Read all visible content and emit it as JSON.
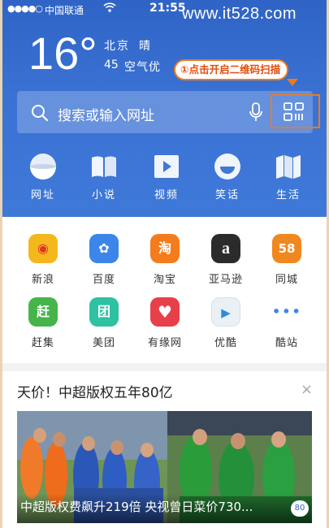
{
  "status_bar": {
    "signal": "●●●●○",
    "carrier": "中国联通",
    "time": "21:55"
  },
  "watermark": "www.it528.com",
  "weather": {
    "temperature": "16°",
    "city": "北京",
    "condition": "晴",
    "aqi_value": "45",
    "aqi_label": "空气优"
  },
  "annotation": {
    "text": "①点击开启二维码扫描",
    "color": "#f07a1a"
  },
  "search": {
    "placeholder": "搜索或输入网址",
    "search_icon": "search-icon",
    "mic_icon": "microphone-icon",
    "scan_icon": "qr-scan-icon"
  },
  "quick_links": [
    {
      "label": "网址",
      "icon": "globe-icon"
    },
    {
      "label": "小说",
      "icon": "book-icon"
    },
    {
      "label": "视频",
      "icon": "play-icon"
    },
    {
      "label": "笑话",
      "icon": "smile-icon"
    },
    {
      "label": "生活",
      "icon": "map-icon"
    }
  ],
  "sites": [
    {
      "label": "新浪",
      "glyph": "◉",
      "color": "#f5b81c"
    },
    {
      "label": "百度",
      "glyph": "✿",
      "color": "#3b86e8"
    },
    {
      "label": "淘宝",
      "glyph": "淘",
      "color": "#f47c1c"
    },
    {
      "label": "亚马逊",
      "glyph": "a",
      "color": "#2b2b2b"
    },
    {
      "label": "同城",
      "glyph": "58",
      "color": "#f0881f"
    },
    {
      "label": "赶集",
      "glyph": "赶",
      "color": "#45b54a"
    },
    {
      "label": "美团",
      "glyph": "团",
      "color": "#2fc1a2"
    },
    {
      "label": "有缘网",
      "glyph": "♥",
      "color": "#e8404a"
    },
    {
      "label": "优酷",
      "glyph": "▶",
      "color": "#e9f1f6"
    },
    {
      "label": "酷站",
      "glyph": "•••",
      "color": "#ffffff"
    }
  ],
  "news": {
    "title": "天价！中超版权五年80亿",
    "close": "×",
    "caption": "中超版权费飙升219倍 央视曾日菜价730...",
    "badge": "80"
  }
}
